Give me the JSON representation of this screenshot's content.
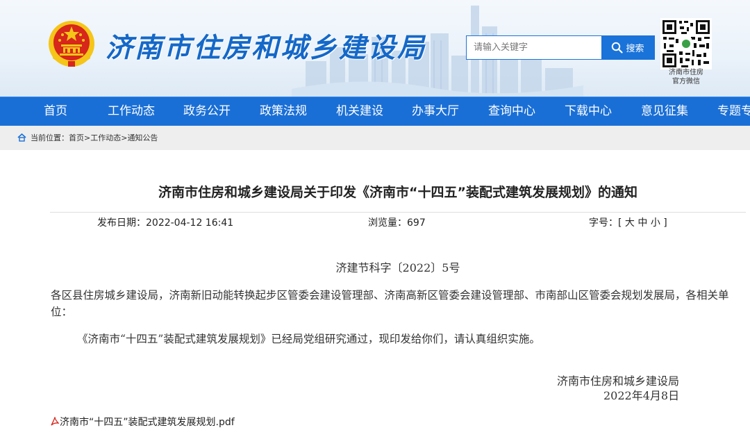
{
  "header": {
    "site_title": "济南市住房和城乡建设局",
    "search": {
      "placeholder": "请输入关键字",
      "button_label": "搜索"
    },
    "qr": {
      "label_line1": "济南市住房",
      "label_line2": "官方微信"
    }
  },
  "nav": {
    "items": [
      {
        "label": "首页"
      },
      {
        "label": "工作动态"
      },
      {
        "label": "政务公开"
      },
      {
        "label": "政策法规"
      },
      {
        "label": "机关建设"
      },
      {
        "label": "办事大厅"
      },
      {
        "label": "查询中心"
      },
      {
        "label": "下载中心"
      },
      {
        "label": "意见征集"
      },
      {
        "label": "专题专"
      }
    ]
  },
  "breadcrumb": {
    "prefix": "当前位置：",
    "items": [
      "首页",
      "工作动态",
      "通知公告"
    ],
    "separator": ">"
  },
  "article": {
    "title": "济南市住房和城乡建设局关于印发《济南市“十四五”装配式建筑发展规划》的通知",
    "publish_label": "发布日期：",
    "publish_date": "2022-04-12 16:41",
    "views_label": "浏览量：",
    "views": "697",
    "font_size_label": "字号：[",
    "font_sizes": [
      "大",
      "中",
      "小"
    ],
    "font_size_close": "]",
    "doc_number": "济建节科字〔2022〕5号",
    "paragraph1": "各区县住房城乡建设局，济南新旧动能转换起步区管委会建设管理部、济南高新区管委会建设管理部、市南部山区管委会规划发展局，各相关单位：",
    "paragraph2": "《济南市“十四五”装配式建筑发展规划》已经局党组研究通过，现印发给你们，请认真组织实施。",
    "signature_org": "济南市住房和城乡建设局",
    "signature_date": "2022年4月8日",
    "attachment": "济南市“十四五”装配式建筑发展规划.pdf"
  },
  "colors": {
    "brand_blue": "#1a6fd6",
    "title_blue": "#1468c8",
    "emblem_red": "#d7261b",
    "emblem_gold": "#f5c518"
  },
  "icons": [
    "national-emblem-icon",
    "search-icon",
    "qr-code-icon",
    "home-icon",
    "pdf-icon"
  ]
}
